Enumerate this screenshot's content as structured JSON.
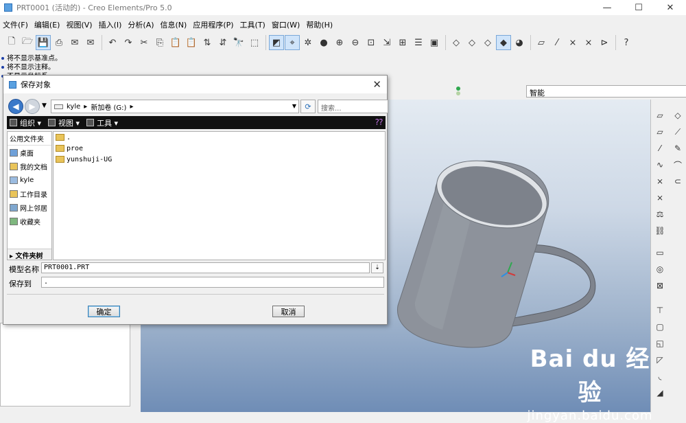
{
  "app": {
    "title": "PRT0001 (活动的) - Creo Elements/Pro 5.0",
    "minimize": "—",
    "maximize": "☐",
    "close": "✕"
  },
  "menubar": [
    "文件(F)",
    "编辑(E)",
    "视图(V)",
    "插入(I)",
    "分析(A)",
    "信息(N)",
    "应用程序(P)",
    "工具(T)",
    "窗口(W)",
    "帮助(H)"
  ],
  "messages": [
    "将不显示基准点。",
    "将不显示注释。",
    "不显示坐标系。"
  ],
  "filter": {
    "selected": "智能"
  },
  "dialog": {
    "title": "保存对象",
    "close": "✕",
    "address": {
      "crumbs": [
        "kyle",
        "▸",
        "新加卷 (G:)",
        "▸"
      ],
      "search_placeholder": "搜索..."
    },
    "commands": {
      "organize": "组织 ▾",
      "views": "视图 ▾",
      "tools": "工具 ▾"
    },
    "places": {
      "header": "公用文件夹",
      "items": [
        "桌面",
        "我的文档",
        "kyle",
        "工作目录",
        "网上邻居",
        "收藏夹"
      ],
      "footer": "▸ 文件夹树"
    },
    "files": [
      ".",
      "proe",
      "yunshuji-UG"
    ],
    "model_name_label": "模型名称",
    "model_name_value": "PRT0001.PRT",
    "save_to_label": "保存到",
    "save_to_value": ".",
    "ok_label": "确定",
    "cancel_label": "取消"
  },
  "watermark": {
    "line1": "Bai du 经验",
    "line2": "jingyan.baidu.com"
  },
  "colors": {
    "dialog_bg": "#f0f0f0",
    "cmdbar_bg": "#111111",
    "accent": "#3b79c9",
    "model_gray": "#8d929b"
  }
}
